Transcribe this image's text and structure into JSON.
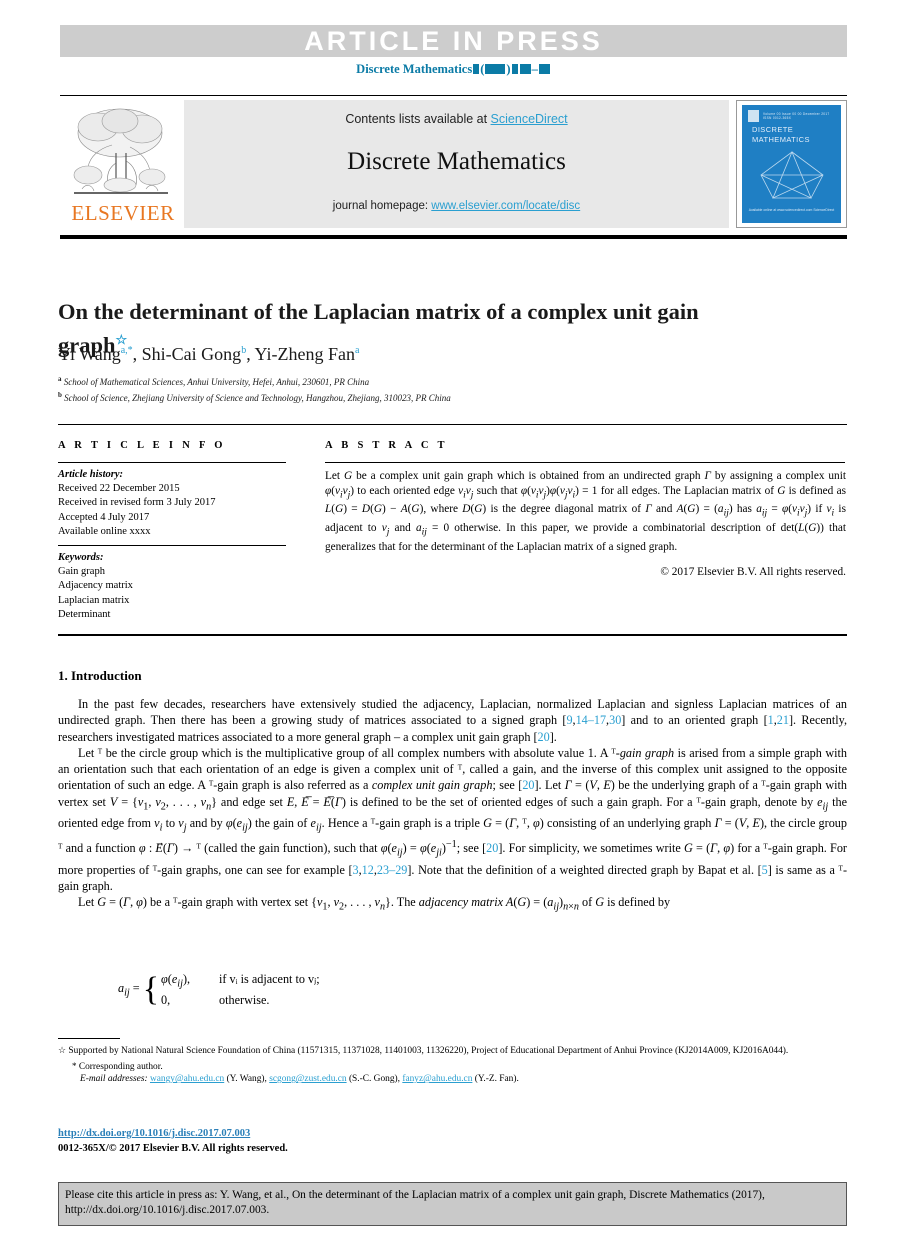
{
  "banner": {
    "article_in_press": "ARTICLE  IN  PRESS",
    "masthead_prefix": "Discrete Mathematics"
  },
  "journal_header": {
    "contents_prefix": "Contents lists available at ",
    "sciencedirect": "ScienceDirect",
    "journal_name": "Discrete Mathematics",
    "homepage_prefix": "journal homepage: ",
    "homepage_url": "www.elsevier.com/locate/disc",
    "publisher": "ELSEVIER",
    "cover_title": "DISCRETE MATHEMATICS",
    "cover_topbar_text": "Volume 00  Issue 00  00 December 2017   ISSN 0012-365X",
    "cover_footer": "Available online at www.sciencedirect.com\nScienceDirect"
  },
  "article": {
    "title": "On the determinant of the Laplacian matrix of a complex unit gain graph",
    "title_star": "☆",
    "authors_html": "Yi Wang <sup>a,*</sup>, Shi-Cai Gong <sup>b</sup>, Yi-Zheng Fan <sup>a</sup>",
    "authors_plain": "Yi Wang a,*, Shi-Cai Gong b, Yi-Zheng Fan a",
    "affiliations": [
      {
        "mark": "a",
        "text": "School of Mathematical Sciences, Anhui University, Hefei, Anhui, 230601, PR China"
      },
      {
        "mark": "b",
        "text": "School of Science, Zhejiang University of Science and Technology, Hangzhou, Zhejiang, 310023, PR China"
      }
    ]
  },
  "article_info": {
    "heading": "A R T I C L E   I N F O",
    "history_label": "Article history:",
    "history": [
      "Received 22 December 2015",
      "Received in revised form 3 July 2017",
      "Accepted 4 July 2017",
      "Available online xxxx"
    ],
    "keywords_label": "Keywords:",
    "keywords": [
      "Gain graph",
      "Adjacency matrix",
      "Laplacian matrix",
      "Determinant"
    ]
  },
  "abstract": {
    "heading": "A B S T R A C T",
    "text_html": "Let <i>G</i> be a complex unit gain graph which is obtained from an undirected graph <i>Γ</i> by assigning a complex unit <i>φ</i>(<i>v<sub>i</sub>v<sub>j</sub></i>) to each oriented edge <i>v<sub>i</sub>v<sub>j</sub></i> such that <i>φ</i>(<i>v<sub>i</sub>v<sub>j</sub></i>)<i>φ</i>(<i>v<sub>j</sub>v<sub>i</sub></i>) = 1 for all edges. The Laplacian matrix of <i>G</i> is defined as <i>L</i>(<i>G</i>) = <i>D</i>(<i>G</i>) − <i>A</i>(<i>G</i>), where <i>D</i>(<i>G</i>) is the degree diagonal matrix of <i>Γ</i> and <i>A</i>(<i>G</i>) = (<i>a<sub>ij</sub></i>) has <i>a<sub>ij</sub></i> = <i>φ</i>(<i>v<sub>i</sub>v<sub>j</sub></i>) if <i>v<sub>i</sub></i> is adjacent to <i>v<sub>j</sub></i> and <i>a<sub>ij</sub></i> = 0 otherwise. In this paper, we provide a combinatorial description of det(<i>L</i>(<i>G</i>)) that generalizes that for the determinant of the Laplacian matrix of a signed graph.",
    "copyright": "© 2017 Elsevier B.V. All rights reserved."
  },
  "body": {
    "section_title": "1.  Introduction",
    "paragraphs_html": [
      "In the past few decades, researchers have extensively studied the adjacency, Laplacian, normalized Laplacian and signless Laplacian matrices of an undirected graph. Then there has been a growing study of matrices associated to a signed graph [<span class=\"ref\">9</span>,<span class=\"ref\">14–17</span>,<span class=\"ref\">30</span>] and to an oriented graph [<span class=\"ref\">1</span>,<span class=\"ref\">21</span>]. Recently, researchers investigated matrices associated to a more general graph – a complex unit gain graph [<span class=\"ref\">20</span>].",
      "Let ᵀ be the circle group which is the multiplicative group of all complex numbers with absolute value 1. A ᵀ-<i>gain graph</i> is arised from a simple graph with an orientation such that each orientation of an edge is given a complex unit of ᵀ, called a gain, and the inverse of this complex unit assigned to the opposite orientation of such an edge. A ᵀ-gain graph is also referred as a <i>complex unit gain graph</i>; see [<span class=\"ref\">20</span>]. Let <i>Γ</i> = (<i>V</i>, <i>E</i>) be the underlying graph of a ᵀ-gain graph with vertex set <i>V</i> = {<i>v</i><sub>1</sub>, <i>v</i><sub>2</sub>, . . . , <i>v<sub>n</sub></i>} and edge set <i>E</i>, <i>E</i>̅ = <i>E</i>̅(<i>Γ</i>) is defined to be the set of oriented edges of such a gain graph. For a ᵀ-gain graph, denote by <i>e<sub>ij</sub></i> the oriented edge from <i>v<sub>i</sub></i> to <i>v<sub>j</sub></i> and by <i>φ</i>(<i>e<sub>ij</sub></i>) the gain of <i>e<sub>ij</sub></i>. Hence a ᵀ-gain graph is a triple <i>G</i> = (<i>Γ</i>, ᵀ, <i>φ</i>) consisting of an underlying graph <i>Γ</i> = (<i>V</i>, <i>E</i>), the circle group ᵀ and a function <i>φ</i> : <i>E</i>⃗(<i>Γ</i>) → ᵀ (called the gain function), such that <i>φ</i>(<i>e<sub>ij</sub></i>) = <i>φ</i>(<i>e<sub>ji</sub></i>)<sup>−1</sup>; see [<span class=\"ref\">20</span>]. For simplicity, we sometimes write <i>G</i> = (<i>Γ</i>, <i>φ</i>) for a ᵀ-gain graph. For more properties of ᵀ-gain graphs, one can see for example [<span class=\"ref\">3</span>,<span class=\"ref\">12</span>,<span class=\"ref\">23–29</span>]. Note that the definition of a weighted directed graph by Bapat et al. [<span class=\"ref\">5</span>] is same as a ᵀ-gain graph.",
      "Let <i>G</i> = (<i>Γ</i>, <i>φ</i>) be a ᵀ-gain graph with vertex set {<i>v</i><sub>1</sub>, <i>v</i><sub>2</sub>, . . . , <i>v<sub>n</sub></i>}. The <i>adjacency matrix A</i>(<i>G</i>) = (<i>a<sub>ij</sub></i>)<sub><i>n</i>×<i>n</i></sub> of <i>G</i> is defined by"
    ],
    "equation": {
      "lhs": "a",
      "lhs_sub": "ij",
      "equals": "=",
      "case1_value": "φ(e",
      "case1_sub": "ij",
      "case1_tail": "),",
      "case1_cond": "if vᵢ is adjacent to vⱼ;",
      "case2_value": "0,",
      "case2_cond": "otherwise."
    }
  },
  "footnotes": {
    "funding_symbol": "☆",
    "funding": "Supported by National Natural Science Foundation of China (11571315, 11371028, 11401003, 11326220), Project of Educational Department of Anhui Province (KJ2014A009, KJ2016A044).",
    "corresponding_symbol": "*",
    "corresponding": "Corresponding author.",
    "email_label": "E-mail addresses:",
    "emails": [
      {
        "address": "wangy@ahu.edu.cn",
        "person": "(Y. Wang)"
      },
      {
        "address": "scgong@zust.edu.cn",
        "person": "(S.-C. Gong)"
      },
      {
        "address": "fanyz@ahu.edu.cn",
        "person": "(Y.-Z. Fan)"
      }
    ]
  },
  "footer": {
    "doi": "http://dx.doi.org/10.1016/j.disc.2017.07.003",
    "issn_copyright": "0012-365X/© 2017 Elsevier B.V. All rights reserved.",
    "cite_text": "Please cite this article in press as: Y. Wang, et al., On the determinant of the Laplacian matrix of a complex unit gain graph, Discrete Mathematics (2017), http://dx.doi.org/10.1016/j.disc.2017.07.003."
  },
  "colors": {
    "link_blue": "#2a9fd0",
    "masthead_blue": "#0b7ba6",
    "elsevier_orange": "#e87722",
    "banner_gray": "#cdcdcd",
    "header_band_gray": "#e8e8e8",
    "cite_box_gray": "#c9c9c9",
    "cover_blue": "#1f7fc4"
  }
}
